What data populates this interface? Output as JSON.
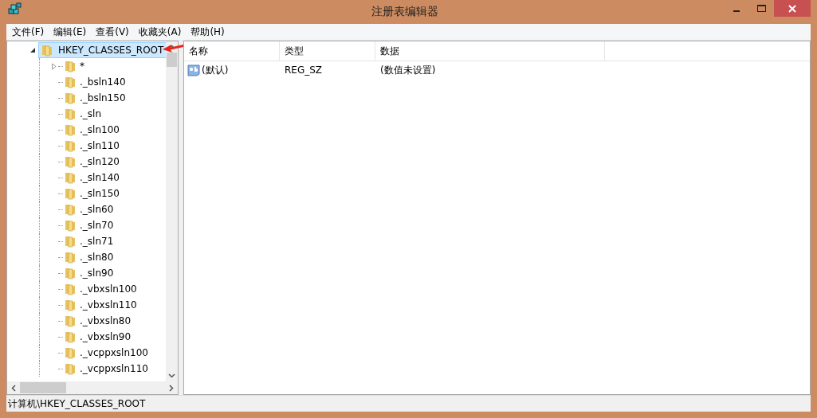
{
  "window": {
    "title": "注册表编辑器"
  },
  "menu": [
    "文件(F)",
    "编辑(E)",
    "查看(V)",
    "收藏夹(A)",
    "帮助(H)"
  ],
  "tree": {
    "label": "HKEY_CLASSES_ROOT",
    "expanded": true,
    "selected": true,
    "children": [
      {
        "label": "*",
        "kind": "branch"
      },
      {
        "label": "._bsln140",
        "kind": "leaf"
      },
      {
        "label": "._bsln150",
        "kind": "leaf"
      },
      {
        "label": "._sln",
        "kind": "leaf"
      },
      {
        "label": "._sln100",
        "kind": "leaf"
      },
      {
        "label": "._sln110",
        "kind": "leaf"
      },
      {
        "label": "._sln120",
        "kind": "leaf"
      },
      {
        "label": "._sln140",
        "kind": "leaf"
      },
      {
        "label": "._sln150",
        "kind": "leaf"
      },
      {
        "label": "._sln60",
        "kind": "leaf"
      },
      {
        "label": "._sln70",
        "kind": "leaf"
      },
      {
        "label": "._sln71",
        "kind": "leaf"
      },
      {
        "label": "._sln80",
        "kind": "leaf"
      },
      {
        "label": "._sln90",
        "kind": "leaf"
      },
      {
        "label": "._vbxsln100",
        "kind": "leaf"
      },
      {
        "label": "._vbxsln110",
        "kind": "leaf"
      },
      {
        "label": "._vbxsln80",
        "kind": "leaf"
      },
      {
        "label": "._vbxsln90",
        "kind": "leaf"
      },
      {
        "label": "._vcppxsln100",
        "kind": "leaf"
      },
      {
        "label": "._vcppxsln110",
        "kind": "leaf"
      }
    ]
  },
  "table": {
    "columns": [
      "名称",
      "类型",
      "数据"
    ],
    "rows": [
      {
        "name": "(默认)",
        "type": "REG_SZ",
        "data": "(数值未设置)"
      }
    ]
  },
  "status_bar": "计算机\\HKEY_CLASSES_ROOT"
}
